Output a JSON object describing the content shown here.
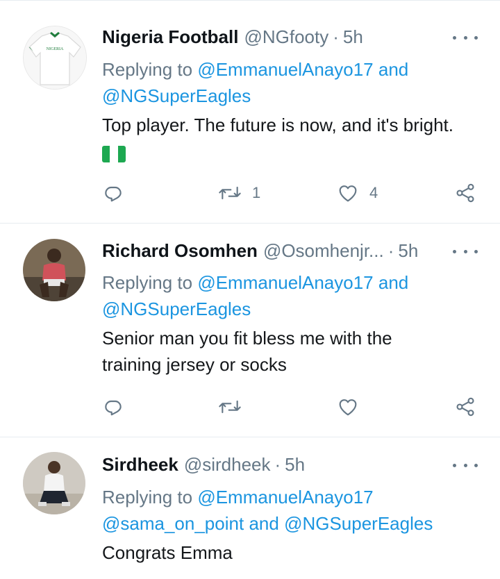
{
  "tweets": [
    {
      "name": "Nigeria Football",
      "handle": "@NGfooty",
      "separator": "·",
      "time": "5h",
      "replying_prefix": "Replying to",
      "reply_line1_mention": "@EmmanuelAnayo17",
      "reply_line1_suffix": "and",
      "reply_line2_mention": "@NGSuperEagles",
      "text": "Top player. The future is now, and it's bright.",
      "avatar_lettering": "NIGERIA",
      "retweet_count": "1",
      "like_count": "4"
    },
    {
      "name": "Richard Osomhen",
      "handle": "@Osomhenjr...",
      "separator": "·",
      "time": "5h",
      "replying_prefix": "Replying to",
      "reply_line1_mention": "@EmmanuelAnayo17",
      "reply_line1_suffix": "and",
      "reply_line2_mention": "@NGSuperEagles",
      "text_line1": "Senior man you fit bless me with the",
      "text_line2": "training jersey or socks"
    },
    {
      "name": "Sirdheek",
      "handle": "@sirdheek",
      "separator": "·",
      "time": "5h",
      "replying_prefix": "Replying to",
      "reply_line1_mention": "@EmmanuelAnayo17",
      "reply_line2_mention_a": "@sama_on_point",
      "reply_line2_and": "and",
      "reply_line2_mention_b": "@NGSuperEagles",
      "text": "Congrats Emma"
    }
  ],
  "icons": {
    "more": "more-horizontal-icon",
    "reply": "comment-icon",
    "retweet": "retweet-icon",
    "like": "heart-icon",
    "share": "share-icon",
    "flag": "nigeria-flag-emoji"
  },
  "colors": {
    "link": "#1b95e0",
    "secondary": "#657786",
    "divider": "#e6ecf0",
    "flag_green": "#1da851"
  }
}
